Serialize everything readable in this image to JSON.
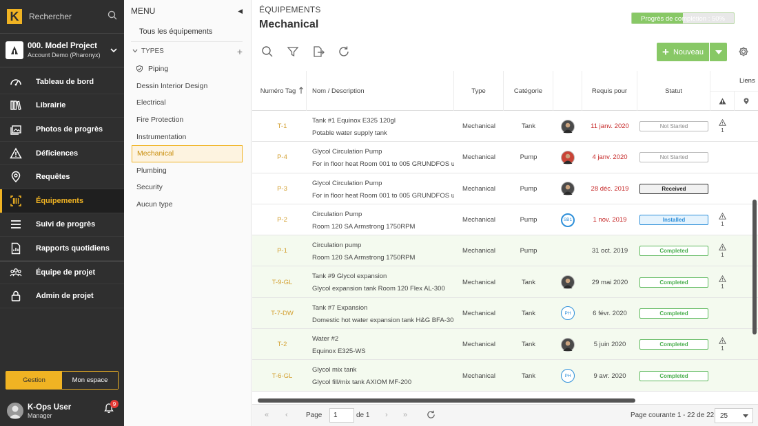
{
  "nav": {
    "logo_letter": "K",
    "search_label": "Rechercher",
    "project_name": "000. Model Project",
    "project_account": "Account Demo (Pharonyx)",
    "items": [
      {
        "label": "Tableau de bord",
        "icon": "dashboard-icon"
      },
      {
        "label": "Librairie",
        "icon": "library-icon"
      },
      {
        "label": "Photos de progrès",
        "icon": "photos-icon"
      },
      {
        "label": "Déficiences",
        "icon": "warning-icon"
      },
      {
        "label": "Requêtes",
        "icon": "location-pin-icon"
      },
      {
        "label": "Équipements",
        "icon": "barcode-icon",
        "active": true
      },
      {
        "label": "Suivi de progrès",
        "icon": "progress-list-icon"
      },
      {
        "label": "Rapports quotidiens",
        "icon": "report-icon"
      },
      {
        "label": "Équipe de projet",
        "icon": "team-icon"
      },
      {
        "label": "Admin de projet",
        "icon": "lock-icon"
      }
    ],
    "mode_gestion": "Gestion",
    "mode_mon_espace": "Mon espace",
    "user_name": "K-Ops User",
    "user_role": "Manager",
    "notifications": "9",
    "accent": "#f0b323"
  },
  "menu": {
    "title": "MENU",
    "all_label": "Tous les équipements",
    "types_label": "TYPES",
    "types": [
      "Piping",
      "Dessin Interior Design",
      "Electrical",
      "Fire Protection",
      "Instrumentation",
      "Mechanical",
      "Plumbing",
      "Security",
      "Aucun type"
    ],
    "active_type": "Mechanical"
  },
  "main": {
    "breadcrumb": "ÉQUIPEMENTS",
    "title": "Mechanical",
    "progress_label": "Progrès de complétion : 50%",
    "progress_value": 50,
    "new_button": "Nouveau",
    "accent_green": "#88c866"
  },
  "table": {
    "headers": {
      "tag": "Numéro Tag",
      "name": "Nom / Description",
      "type": "Type",
      "category": "Catégorie",
      "required": "Requis pour",
      "status": "Statut",
      "links": "Liens"
    },
    "rows": [
      {
        "tag": "T-1",
        "name": "Tank #1 Equinox E325 120gl",
        "desc": "Potable water supply tank",
        "type": "Mechanical",
        "category": "Tank",
        "assignee": "photo",
        "assignee_text": "",
        "date": "11 janv. 2020",
        "late": true,
        "status": "Not Started",
        "status_kind": "ns",
        "warning": "1"
      },
      {
        "tag": "P-4",
        "name": "Glycol Circulation Pump",
        "desc": "For in floor heat Room 001 to 005 GRUNDFOS u",
        "type": "Mechanical",
        "category": "Pump",
        "assignee": "red",
        "assignee_text": "",
        "date": "4 janv. 2020",
        "late": true,
        "status": "Not Started",
        "status_kind": "ns",
        "warning": ""
      },
      {
        "tag": "P-3",
        "name": "Glycol Circulation Pump",
        "desc": "For in floor heat Room 001 to 005 GRUNDFOS u",
        "type": "Mechanical",
        "category": "Pump",
        "assignee": "photo",
        "assignee_text": "",
        "date": "28 déc. 2019",
        "late": true,
        "status": "Received",
        "status_kind": "rc",
        "warning": ""
      },
      {
        "tag": "P-2",
        "name": "Circulation Pump",
        "desc": "Room 120 SA Armstrong 1750RPM",
        "type": "Mechanical",
        "category": "Pump",
        "assignee": "blue",
        "assignee_text": "SB1",
        "date": "1 nov. 2019",
        "late": true,
        "status": "Installed",
        "status_kind": "in",
        "warning": "1"
      },
      {
        "tag": "P-1",
        "name": "Circulation pump",
        "desc": "Room 120 SA Armstrong 1750RPM",
        "type": "Mechanical",
        "category": "Pump",
        "assignee": "",
        "assignee_text": "",
        "date": "31 oct. 2019",
        "late": false,
        "status": "Completed",
        "status_kind": "cp",
        "warning": "1"
      },
      {
        "tag": "T-9-GL",
        "name": "Tank #9 Glycol expansion",
        "desc": "Glycol expansion tank Room 120 Flex AL-300",
        "type": "Mechanical",
        "category": "Tank",
        "assignee": "photo",
        "assignee_text": "",
        "date": "29 mai 2020",
        "late": false,
        "status": "Completed",
        "status_kind": "cp",
        "warning": "1"
      },
      {
        "tag": "T-7-DW",
        "name": "Tank #7 Expansion",
        "desc": "Domestic hot water expansion tank H&G BFA-30",
        "type": "Mechanical",
        "category": "Tank",
        "assignee": "ring",
        "assignee_text": "PH",
        "date": "6 févr. 2020",
        "late": false,
        "status": "Completed",
        "status_kind": "cp",
        "warning": ""
      },
      {
        "tag": "T-2",
        "name": "Water #2",
        "desc": "Equinox E325-WS",
        "type": "Mechanical",
        "category": "Tank",
        "assignee": "photo",
        "assignee_text": "",
        "date": "5 juin 2020",
        "late": false,
        "status": "Completed",
        "status_kind": "cp",
        "warning": "1"
      },
      {
        "tag": "T-6-GL",
        "name": "Glycol mix tank",
        "desc": "Glycol fill/mix tank AXIOM MF-200",
        "type": "Mechanical",
        "category": "Tank",
        "assignee": "ring",
        "assignee_text": "PH",
        "date": "9 avr. 2020",
        "late": false,
        "status": "Completed",
        "status_kind": "cp",
        "warning": ""
      }
    ]
  },
  "pager": {
    "page_label": "Page",
    "page_value": "1",
    "of_label": "de 1",
    "info": "Page courante 1 - 22 de 22",
    "page_size": "25"
  }
}
